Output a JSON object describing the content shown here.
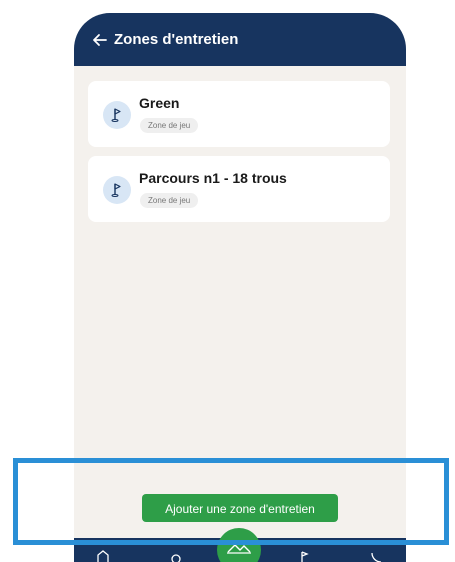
{
  "header": {
    "title": "Zones d'entretien"
  },
  "zones": [
    {
      "name": "Green",
      "type": "Zone de jeu"
    },
    {
      "name": "Parcours n1 - 18 trous",
      "type": "Zone de jeu"
    }
  ],
  "actions": {
    "add_label": "Ajouter une zone d'entretien"
  },
  "colors": {
    "header": "#17345f",
    "accent": "#2e9e48",
    "background": "#f4f1ed",
    "highlight": "#2a8fd6"
  }
}
